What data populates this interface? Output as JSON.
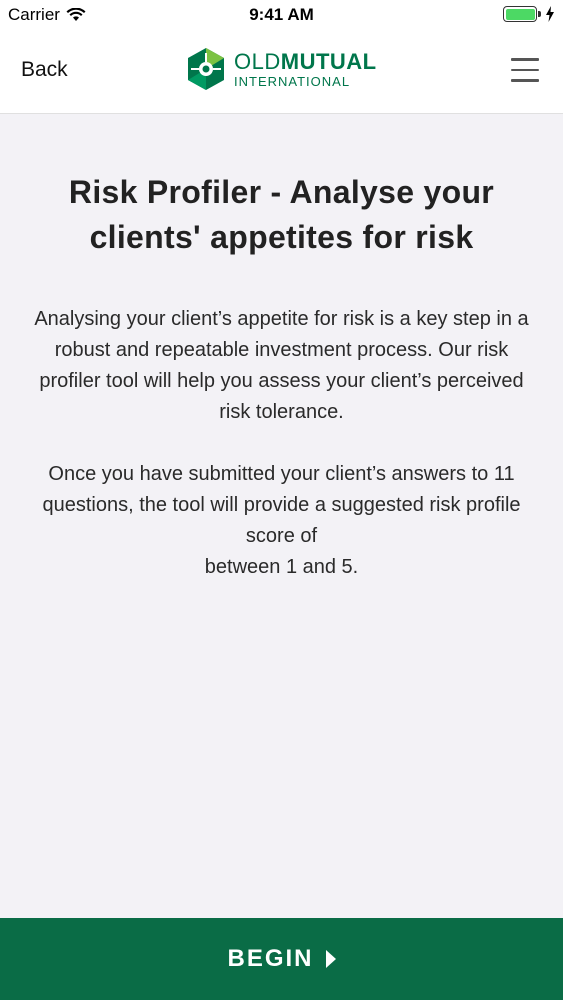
{
  "status_bar": {
    "carrier": "Carrier",
    "time": "9:41 AM",
    "battery_color": "#4cd964"
  },
  "nav": {
    "back_label": "Back",
    "logo_line1_light": "OLD",
    "logo_line1_bold": "MUTUAL",
    "logo_line2": "INTERNATIONAL",
    "menu_icon": "hamburger-menu-icon",
    "brand_color": "#00764b"
  },
  "content": {
    "title": "Risk Profiler - Analyse your clients' appetites for risk",
    "paragraph1": "Analysing your client’s appetite for risk is a key step in a robust and repeatable investment process. Our risk profiler tool will help you assess your client’s perceived risk tolerance.",
    "paragraph2_part1": "Once you have submitted your client’s answers to 11 questions, the tool will provide a suggested risk profile score of",
    "paragraph2_part2": "between 1 and 5."
  },
  "footer": {
    "begin_label": "BEGIN",
    "background_color": "#0a6c46"
  }
}
